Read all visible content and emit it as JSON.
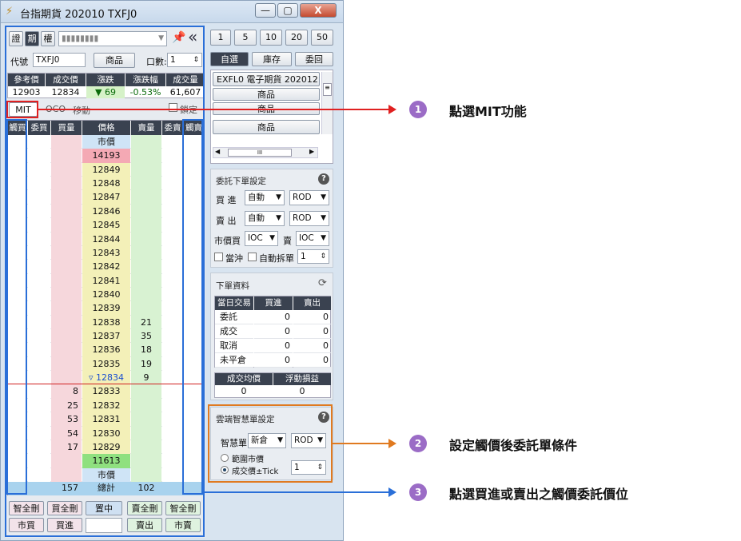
{
  "window": {
    "title": "台指期貨 202010 TXFJ0",
    "controls": [
      "—",
      "▢",
      "X"
    ]
  },
  "left": {
    "type_tabs": [
      "證",
      "期",
      "權"
    ],
    "account_masked": "▮▮▮▮▮▮▮▮",
    "code_label": "代號",
    "code_value": "TXFJ0",
    "product_button": "商品",
    "qty_label": "口數:",
    "qty_value": "1",
    "quote_headers": [
      "參考價",
      "成交價",
      "漲跌",
      "漲跌幅",
      "成交量"
    ],
    "quote_values": [
      "12903",
      "12834",
      "▼ 69",
      "-0.53%",
      "61,607"
    ],
    "order_tabs": [
      "MIT",
      "OCO",
      "移動"
    ],
    "lock_label": "鎖定",
    "ladder_headers": [
      "觸買",
      "委買",
      "買量",
      "價格",
      "賣量",
      "委賣",
      "觸賣"
    ],
    "ladder_rows": [
      {
        "price": "市價",
        "buy": "",
        "sell": ""
      },
      {
        "price": "14193",
        "buy": "",
        "sell": ""
      },
      {
        "price": "12849",
        "buy": "",
        "sell": ""
      },
      {
        "price": "12848",
        "buy": "",
        "sell": ""
      },
      {
        "price": "12847",
        "buy": "",
        "sell": ""
      },
      {
        "price": "12846",
        "buy": "",
        "sell": ""
      },
      {
        "price": "12845",
        "buy": "",
        "sell": ""
      },
      {
        "price": "12844",
        "buy": "",
        "sell": ""
      },
      {
        "price": "12843",
        "buy": "",
        "sell": ""
      },
      {
        "price": "12842",
        "buy": "",
        "sell": ""
      },
      {
        "price": "12841",
        "buy": "",
        "sell": ""
      },
      {
        "price": "12840",
        "buy": "",
        "sell": ""
      },
      {
        "price": "12839",
        "buy": "",
        "sell": ""
      },
      {
        "price": "12838",
        "buy": "",
        "sell": "21"
      },
      {
        "price": "12837",
        "buy": "",
        "sell": "35"
      },
      {
        "price": "12836",
        "buy": "",
        "sell": "18"
      },
      {
        "price": "12835",
        "buy": "",
        "sell": "19"
      },
      {
        "price": "▿ 12834",
        "buy": "",
        "sell": "9"
      },
      {
        "price": "12833",
        "buy": "8",
        "sell": ""
      },
      {
        "price": "12832",
        "buy": "25",
        "sell": ""
      },
      {
        "price": "12831",
        "buy": "53",
        "sell": ""
      },
      {
        "price": "12830",
        "buy": "54",
        "sell": ""
      },
      {
        "price": "12829",
        "buy": "17",
        "sell": ""
      },
      {
        "price": "11613",
        "buy": "",
        "sell": ""
      },
      {
        "price": "市價",
        "buy": "",
        "sell": ""
      }
    ],
    "totals": {
      "buy": "157",
      "label": "總計",
      "sell": "102"
    },
    "bottom_row1": [
      "智全刪",
      "買全刪",
      "置中",
      "賣全刪",
      "智全刪"
    ],
    "bottom_row2": [
      "市買",
      "買進",
      "",
      "賣出",
      "市賣"
    ]
  },
  "right": {
    "qty_presets": [
      "1",
      "5",
      "10",
      "20",
      "50"
    ],
    "tabs": [
      "自選",
      "庫存",
      "委回"
    ],
    "watch_item": "EXFL0 電子期貨 202012",
    "product_buttons": [
      "商品",
      "商品",
      "商品"
    ],
    "scroll_mid": "III",
    "order_settings": {
      "title": "委託下單設定",
      "buy_label": "買 進",
      "buy_mode": "自動",
      "buy_type": "ROD",
      "sell_label": "賣 出",
      "sell_mode": "自動",
      "sell_type": "ROD",
      "mkt_buy_label": "市價買",
      "mkt_buy": "IOC",
      "mkt_sell_label": "賣",
      "mkt_sell": "IOC",
      "daytrade_label": "當沖",
      "split_label": "自動拆單",
      "split_value": "1"
    },
    "order_info": {
      "title": "下單資料",
      "headers": [
        "當日交易",
        "買進",
        "賣出"
      ],
      "rows": [
        [
          "委託",
          "0",
          "0"
        ],
        [
          "成交",
          "0",
          "0"
        ],
        [
          "取消",
          "0",
          "0"
        ],
        [
          "未平倉",
          "0",
          "0"
        ]
      ],
      "avg_headers": [
        "成交均價",
        "浮動損益"
      ],
      "avg_values": [
        "0",
        "0"
      ]
    },
    "smart_order": {
      "title": "雲端智慧單設定",
      "label": "智慧單",
      "kind": "新倉",
      "type": "ROD",
      "opt1": "範圍市價",
      "opt2": "成交價±Tick",
      "tick_value": "1"
    }
  },
  "annotations": [
    {
      "num": "1",
      "text": "點選MIT功能",
      "color": "#e02020"
    },
    {
      "num": "2",
      "text": "設定觸價後委託單條件",
      "color": "#e07a20"
    },
    {
      "num": "3",
      "text": "點選買進或賣出之觸價委託價位",
      "color": "#2a6fd8"
    }
  ]
}
